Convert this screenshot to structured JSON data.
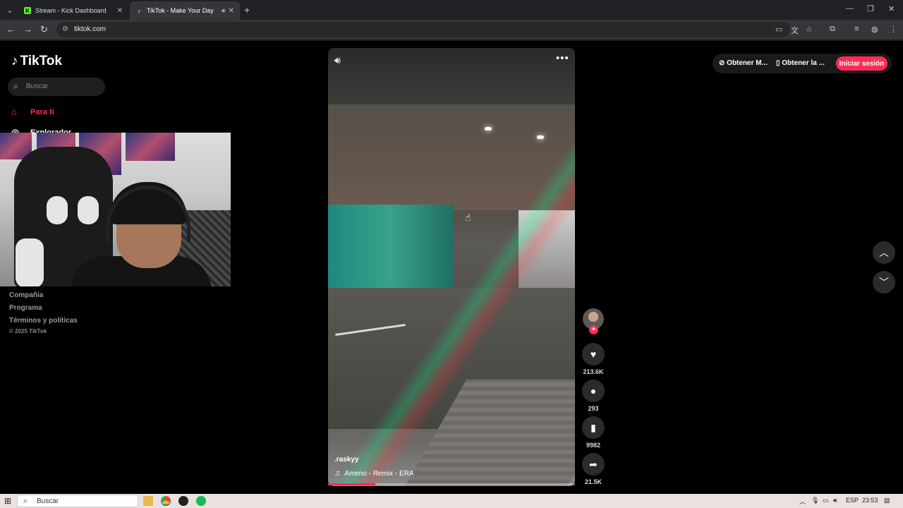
{
  "browser": {
    "tabs": [
      {
        "title": "Stream - Kick Dashboard",
        "favicon": "kick-icon",
        "favicon_color": "#53fc18"
      },
      {
        "title": "TikTok - Make Your Day",
        "favicon": "tiktok-icon",
        "active": true
      }
    ],
    "url": "tiktok.com"
  },
  "tiktok": {
    "logo_text": "TikTok",
    "search_placeholder": "Buscar",
    "nav": {
      "for_you": "Para ti",
      "explore": "Explorador"
    },
    "footer": {
      "company": "Compañía",
      "program": "Programa",
      "terms": "Términos y políticas",
      "copyright": "© 2025 TikTok"
    },
    "header": {
      "get_coins": "Obtener M...",
      "get_app": "Obtener la ...",
      "login": "Iniciar sesión"
    },
    "video": {
      "username": ".raskyy",
      "music": "Ameno - Remix - ERA",
      "progress_fraction": 0.19,
      "likes": "213.6K",
      "comments": "293",
      "saves": "9982",
      "shares": "21.5K"
    },
    "accent_color": "#fe2c55"
  },
  "taskbar": {
    "search_placeholder": "Buscar",
    "language": "ESP",
    "time": "23:53"
  }
}
